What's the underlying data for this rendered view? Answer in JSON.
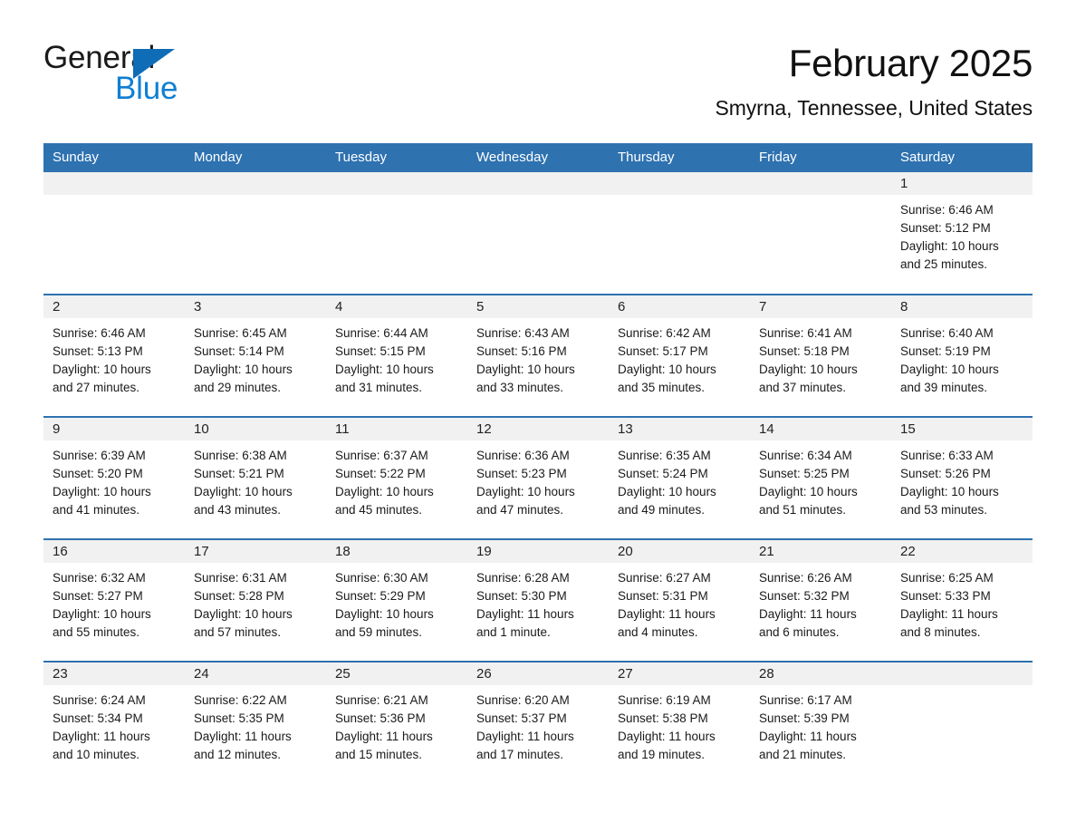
{
  "logo": {
    "word_one": "General",
    "word_two": "Blue",
    "accent_dark": "#0f6cb6",
    "accent_light": "#0f7fd4"
  },
  "header": {
    "month_title": "February 2025",
    "location": "Smyrna, Tennessee, United States"
  },
  "theme": {
    "header_blue": "#2e72b0",
    "daynum_band": "#f1f1f1",
    "text": "#1a1a1a"
  },
  "weekdays": [
    "Sunday",
    "Monday",
    "Tuesday",
    "Wednesday",
    "Thursday",
    "Friday",
    "Saturday"
  ],
  "weeks": [
    [
      {
        "day": "",
        "empty": true
      },
      {
        "day": "",
        "empty": true
      },
      {
        "day": "",
        "empty": true
      },
      {
        "day": "",
        "empty": true
      },
      {
        "day": "",
        "empty": true
      },
      {
        "day": "",
        "empty": true
      },
      {
        "day": "1",
        "sunrise": "Sunrise: 6:46 AM",
        "sunset": "Sunset: 5:12 PM",
        "daylight_line1": "Daylight: 10 hours",
        "daylight_line2": "and 25 minutes."
      }
    ],
    [
      {
        "day": "2",
        "sunrise": "Sunrise: 6:46 AM",
        "sunset": "Sunset: 5:13 PM",
        "daylight_line1": "Daylight: 10 hours",
        "daylight_line2": "and 27 minutes."
      },
      {
        "day": "3",
        "sunrise": "Sunrise: 6:45 AM",
        "sunset": "Sunset: 5:14 PM",
        "daylight_line1": "Daylight: 10 hours",
        "daylight_line2": "and 29 minutes."
      },
      {
        "day": "4",
        "sunrise": "Sunrise: 6:44 AM",
        "sunset": "Sunset: 5:15 PM",
        "daylight_line1": "Daylight: 10 hours",
        "daylight_line2": "and 31 minutes."
      },
      {
        "day": "5",
        "sunrise": "Sunrise: 6:43 AM",
        "sunset": "Sunset: 5:16 PM",
        "daylight_line1": "Daylight: 10 hours",
        "daylight_line2": "and 33 minutes."
      },
      {
        "day": "6",
        "sunrise": "Sunrise: 6:42 AM",
        "sunset": "Sunset: 5:17 PM",
        "daylight_line1": "Daylight: 10 hours",
        "daylight_line2": "and 35 minutes."
      },
      {
        "day": "7",
        "sunrise": "Sunrise: 6:41 AM",
        "sunset": "Sunset: 5:18 PM",
        "daylight_line1": "Daylight: 10 hours",
        "daylight_line2": "and 37 minutes."
      },
      {
        "day": "8",
        "sunrise": "Sunrise: 6:40 AM",
        "sunset": "Sunset: 5:19 PM",
        "daylight_line1": "Daylight: 10 hours",
        "daylight_line2": "and 39 minutes."
      }
    ],
    [
      {
        "day": "9",
        "sunrise": "Sunrise: 6:39 AM",
        "sunset": "Sunset: 5:20 PM",
        "daylight_line1": "Daylight: 10 hours",
        "daylight_line2": "and 41 minutes."
      },
      {
        "day": "10",
        "sunrise": "Sunrise: 6:38 AM",
        "sunset": "Sunset: 5:21 PM",
        "daylight_line1": "Daylight: 10 hours",
        "daylight_line2": "and 43 minutes."
      },
      {
        "day": "11",
        "sunrise": "Sunrise: 6:37 AM",
        "sunset": "Sunset: 5:22 PM",
        "daylight_line1": "Daylight: 10 hours",
        "daylight_line2": "and 45 minutes."
      },
      {
        "day": "12",
        "sunrise": "Sunrise: 6:36 AM",
        "sunset": "Sunset: 5:23 PM",
        "daylight_line1": "Daylight: 10 hours",
        "daylight_line2": "and 47 minutes."
      },
      {
        "day": "13",
        "sunrise": "Sunrise: 6:35 AM",
        "sunset": "Sunset: 5:24 PM",
        "daylight_line1": "Daylight: 10 hours",
        "daylight_line2": "and 49 minutes."
      },
      {
        "day": "14",
        "sunrise": "Sunrise: 6:34 AM",
        "sunset": "Sunset: 5:25 PM",
        "daylight_line1": "Daylight: 10 hours",
        "daylight_line2": "and 51 minutes."
      },
      {
        "day": "15",
        "sunrise": "Sunrise: 6:33 AM",
        "sunset": "Sunset: 5:26 PM",
        "daylight_line1": "Daylight: 10 hours",
        "daylight_line2": "and 53 minutes."
      }
    ],
    [
      {
        "day": "16",
        "sunrise": "Sunrise: 6:32 AM",
        "sunset": "Sunset: 5:27 PM",
        "daylight_line1": "Daylight: 10 hours",
        "daylight_line2": "and 55 minutes."
      },
      {
        "day": "17",
        "sunrise": "Sunrise: 6:31 AM",
        "sunset": "Sunset: 5:28 PM",
        "daylight_line1": "Daylight: 10 hours",
        "daylight_line2": "and 57 minutes."
      },
      {
        "day": "18",
        "sunrise": "Sunrise: 6:30 AM",
        "sunset": "Sunset: 5:29 PM",
        "daylight_line1": "Daylight: 10 hours",
        "daylight_line2": "and 59 minutes."
      },
      {
        "day": "19",
        "sunrise": "Sunrise: 6:28 AM",
        "sunset": "Sunset: 5:30 PM",
        "daylight_line1": "Daylight: 11 hours",
        "daylight_line2": "and 1 minute."
      },
      {
        "day": "20",
        "sunrise": "Sunrise: 6:27 AM",
        "sunset": "Sunset: 5:31 PM",
        "daylight_line1": "Daylight: 11 hours",
        "daylight_line2": "and 4 minutes."
      },
      {
        "day": "21",
        "sunrise": "Sunrise: 6:26 AM",
        "sunset": "Sunset: 5:32 PM",
        "daylight_line1": "Daylight: 11 hours",
        "daylight_line2": "and 6 minutes."
      },
      {
        "day": "22",
        "sunrise": "Sunrise: 6:25 AM",
        "sunset": "Sunset: 5:33 PM",
        "daylight_line1": "Daylight: 11 hours",
        "daylight_line2": "and 8 minutes."
      }
    ],
    [
      {
        "day": "23",
        "sunrise": "Sunrise: 6:24 AM",
        "sunset": "Sunset: 5:34 PM",
        "daylight_line1": "Daylight: 11 hours",
        "daylight_line2": "and 10 minutes."
      },
      {
        "day": "24",
        "sunrise": "Sunrise: 6:22 AM",
        "sunset": "Sunset: 5:35 PM",
        "daylight_line1": "Daylight: 11 hours",
        "daylight_line2": "and 12 minutes."
      },
      {
        "day": "25",
        "sunrise": "Sunrise: 6:21 AM",
        "sunset": "Sunset: 5:36 PM",
        "daylight_line1": "Daylight: 11 hours",
        "daylight_line2": "and 15 minutes."
      },
      {
        "day": "26",
        "sunrise": "Sunrise: 6:20 AM",
        "sunset": "Sunset: 5:37 PM",
        "daylight_line1": "Daylight: 11 hours",
        "daylight_line2": "and 17 minutes."
      },
      {
        "day": "27",
        "sunrise": "Sunrise: 6:19 AM",
        "sunset": "Sunset: 5:38 PM",
        "daylight_line1": "Daylight: 11 hours",
        "daylight_line2": "and 19 minutes."
      },
      {
        "day": "28",
        "sunrise": "Sunrise: 6:17 AM",
        "sunset": "Sunset: 5:39 PM",
        "daylight_line1": "Daylight: 11 hours",
        "daylight_line2": "and 21 minutes."
      },
      {
        "day": "",
        "empty": true
      }
    ]
  ]
}
